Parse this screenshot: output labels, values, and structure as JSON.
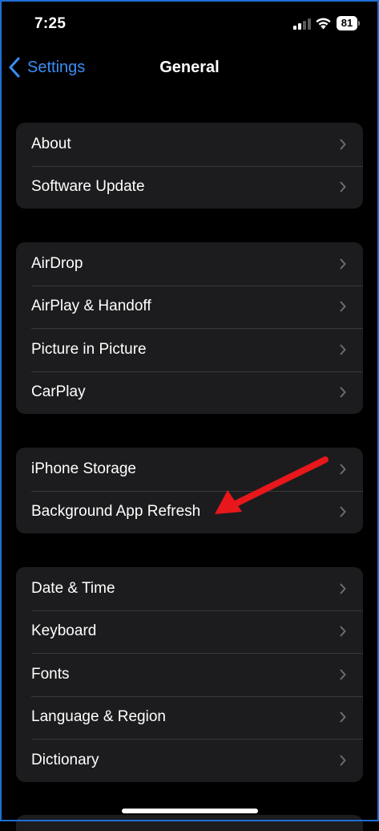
{
  "status_bar": {
    "time": "7:25",
    "battery": "81",
    "signal_icon": "cellular-signal-icon",
    "wifi_icon": "wifi-icon"
  },
  "nav": {
    "back_label": "Settings",
    "title": "General"
  },
  "groups": [
    {
      "rows": [
        {
          "label": "About"
        },
        {
          "label": "Software Update"
        }
      ]
    },
    {
      "rows": [
        {
          "label": "AirDrop"
        },
        {
          "label": "AirPlay & Handoff"
        },
        {
          "label": "Picture in Picture"
        },
        {
          "label": "CarPlay"
        }
      ]
    },
    {
      "rows": [
        {
          "label": "iPhone Storage"
        },
        {
          "label": "Background App Refresh"
        }
      ]
    },
    {
      "rows": [
        {
          "label": "Date & Time"
        },
        {
          "label": "Keyboard"
        },
        {
          "label": "Fonts"
        },
        {
          "label": "Language & Region"
        },
        {
          "label": "Dictionary"
        }
      ]
    }
  ],
  "colors": {
    "accent": "#3a8ef6",
    "background": "#000000",
    "group_background": "#1c1c1e",
    "annotation_arrow": "#e8171b"
  }
}
